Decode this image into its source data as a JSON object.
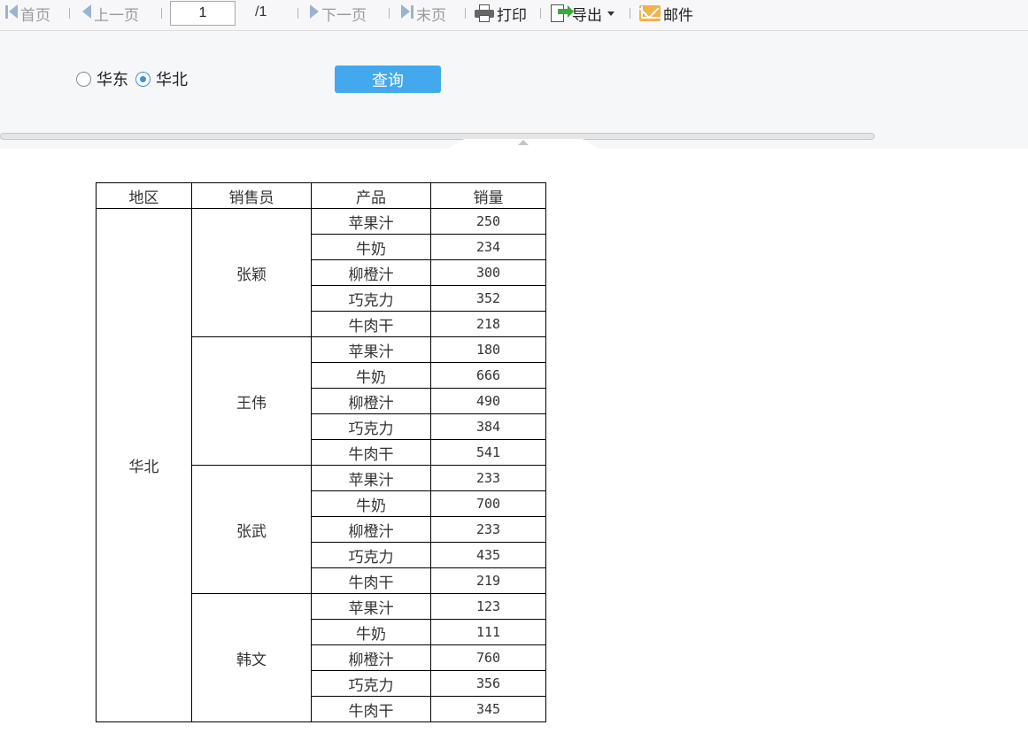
{
  "toolbar": {
    "first_label": "首页",
    "prev_label": "上一页",
    "page_value": "1",
    "page_total": "/1",
    "next_label": "下一页",
    "last_label": "末页",
    "print_label": "打印",
    "export_label": "导出",
    "mail_label": "邮件"
  },
  "params": {
    "region_options": [
      "华东",
      "华北"
    ],
    "selected_region": "华北",
    "query_label": "查询"
  },
  "report": {
    "headers": [
      "地区",
      "销售员",
      "产品",
      "销量"
    ],
    "region": "华北",
    "salespeople": [
      {
        "name": "张颖",
        "rows": [
          [
            "苹果汁",
            "250"
          ],
          [
            "牛奶",
            "234"
          ],
          [
            "柳橙汁",
            "300"
          ],
          [
            "巧克力",
            "352"
          ],
          [
            "牛肉干",
            "218"
          ]
        ]
      },
      {
        "name": "王伟",
        "rows": [
          [
            "苹果汁",
            "180"
          ],
          [
            "牛奶",
            "666"
          ],
          [
            "柳橙汁",
            "490"
          ],
          [
            "巧克力",
            "384"
          ],
          [
            "牛肉干",
            "541"
          ]
        ]
      },
      {
        "name": "张武",
        "rows": [
          [
            "苹果汁",
            "233"
          ],
          [
            "牛奶",
            "700"
          ],
          [
            "柳橙汁",
            "233"
          ],
          [
            "巧克力",
            "435"
          ],
          [
            "牛肉干",
            "219"
          ]
        ]
      },
      {
        "name": "韩文",
        "rows": [
          [
            "苹果汁",
            "123"
          ],
          [
            "牛奶",
            "111"
          ],
          [
            "柳橙汁",
            "760"
          ],
          [
            "巧克力",
            "356"
          ],
          [
            "牛肉干",
            "345"
          ]
        ]
      }
    ]
  },
  "colors": {
    "query_button": "#44a8ec",
    "radio_selected": "#3d8fe0",
    "nav_disabled_icon": "#9ab4cf"
  }
}
